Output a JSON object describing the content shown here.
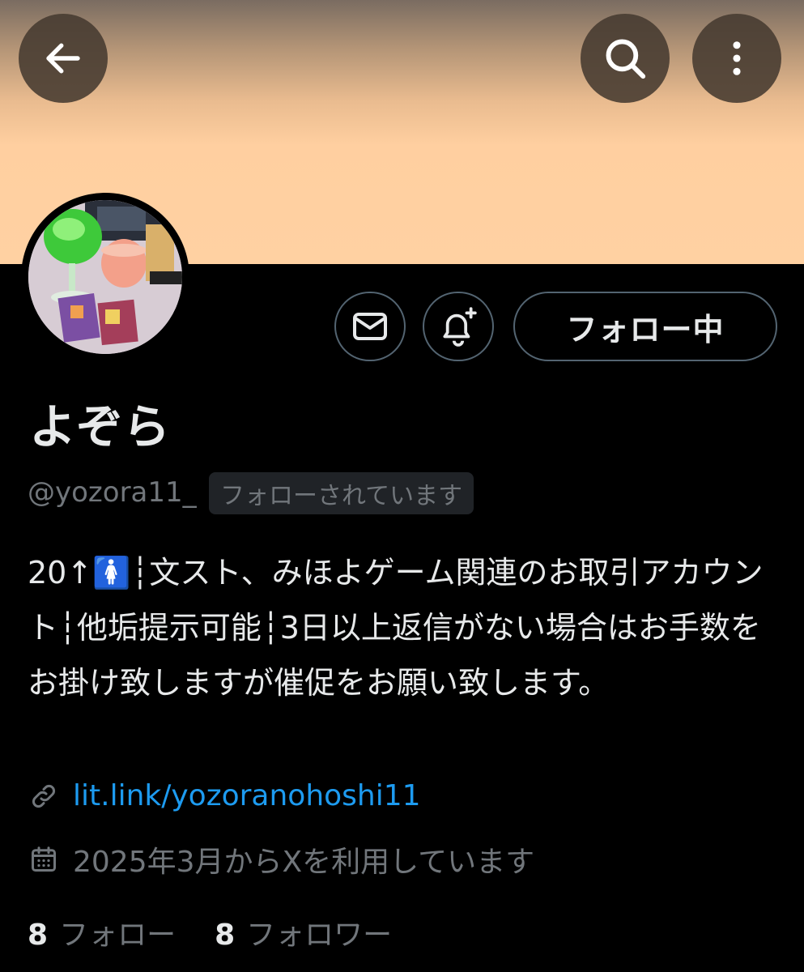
{
  "header": {
    "back_icon": "arrow-left-icon",
    "search_icon": "search-icon",
    "more_icon": "more-vertical-icon"
  },
  "profile": {
    "display_name": "よぞら",
    "handle": "@yozora11_",
    "follows_you_badge": "フォローされています",
    "bio": "20↑🚺┆文スト、みほよゲーム関連のお取引アカウント┆他垢提示可能┆3日以上返信がない場合はお手数をお掛け致しますが催促をお願い致します。",
    "link": "lit.link/yozoranohoshi11",
    "joined": "2025年3月からXを利用しています"
  },
  "actions": {
    "dm_icon": "envelope-icon",
    "notify_icon": "bell-plus-icon",
    "follow_label": "フォロー中"
  },
  "stats": {
    "following_count": "8",
    "following_label": "フォロー",
    "followers_count": "8",
    "followers_label": "フォロワー"
  },
  "colors": {
    "background": "#000000",
    "banner": "#ffd1a2",
    "link": "#1d9bf0",
    "secondary_text": "#71767b",
    "border": "#536471"
  }
}
